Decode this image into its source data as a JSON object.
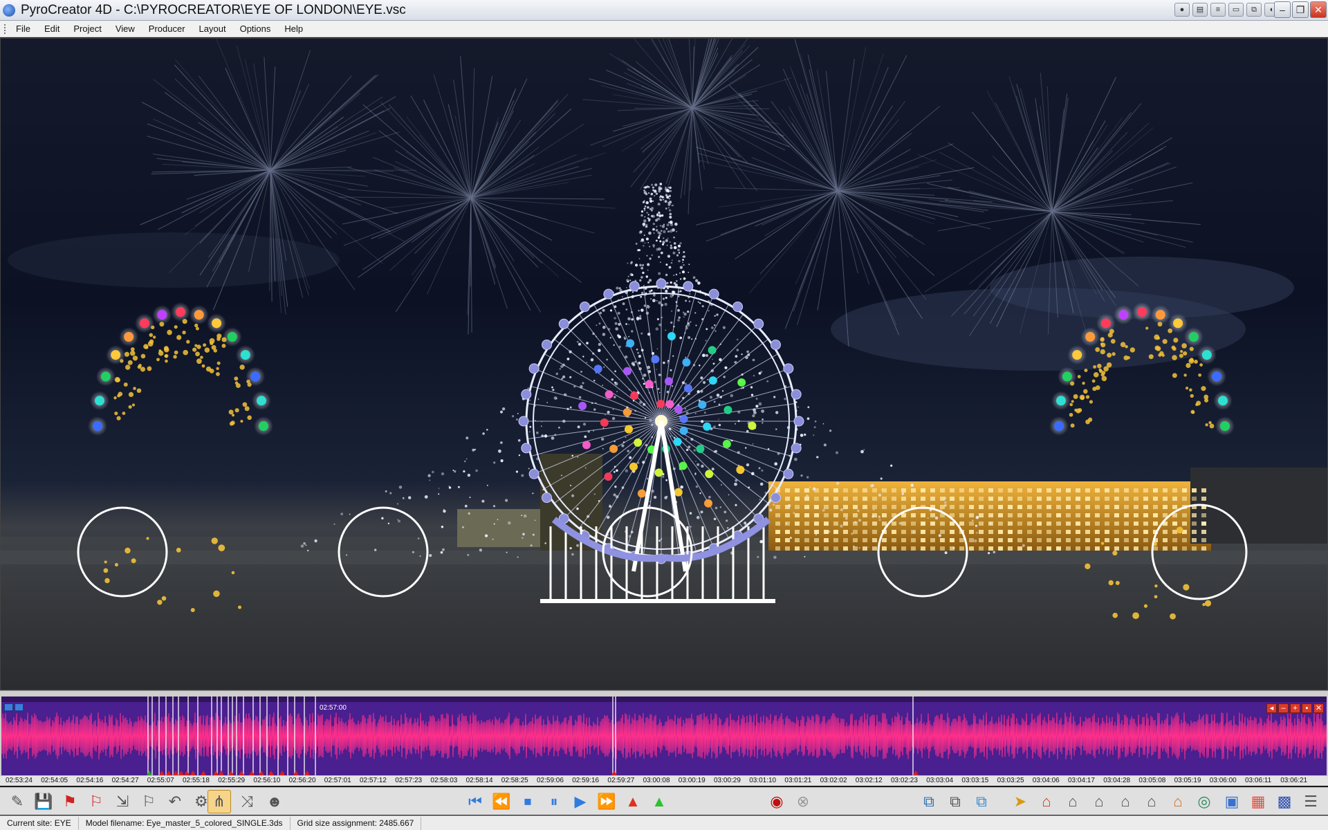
{
  "window": {
    "title": "PyroCreator 4D - C:\\PYROCREATOR\\EYE OF LONDON\\EYE.vsc"
  },
  "menu": [
    "File",
    "Edit",
    "Project",
    "View",
    "Producer",
    "Layout",
    "Options",
    "Help"
  ],
  "timeline": {
    "playhead_label": "02:57:00",
    "ticks": [
      "02:53:24",
      "02:54:05",
      "02:54:16",
      "02:54:27",
      "02:55:07",
      "02:55:18",
      "02:55:29",
      "02:56:10",
      "02:56:20",
      "02:57:01",
      "02:57:12",
      "02:57:23",
      "02:58:03",
      "02:58:14",
      "02:58:25",
      "02:59:06",
      "02:59:16",
      "02:59:27",
      "03:00:08",
      "03:00:19",
      "03:00:29",
      "03:01:10",
      "03:01:21",
      "03:02:02",
      "03:02:12",
      "03:02:23",
      "03:03:04",
      "03:03:15",
      "03:03:25",
      "03:04:06",
      "03:04:17",
      "03:04:28",
      "03:05:08",
      "03:05:19",
      "03:06:00",
      "03:06:11",
      "03:06:21"
    ],
    "wave_color": "#ff2f8a",
    "background_color": "#4a1f8f"
  },
  "toolbar": {
    "icons": [
      "select-tool-icon",
      "disk-icon",
      "red-flag-icon",
      "text-flag-icon",
      "move-cue-icon",
      "flag-gray-icon",
      "undo-icon",
      "settings-gear-icon",
      "magnet-icon",
      "arrow-split-icon",
      "person-icon",
      "skip-start-icon",
      "rewind-icon",
      "stop-icon",
      "pause-icon",
      "play-icon",
      "fast-forward-icon",
      "red-cone-icon",
      "green-cone-icon",
      "record-icon",
      "disabled-record-icon",
      "network-icon",
      "network-gray-icon",
      "network-color-icon",
      "yellow-cursor-icon",
      "house-red-icon",
      "house-cross-icon",
      "house-dark-icon",
      "house-gray-icon",
      "house-arrow-icon",
      "house-orange-icon",
      "globe-icon",
      "image-icon",
      "palette-icon",
      "people-icon",
      "list-icon"
    ]
  },
  "status": {
    "site": "Current site:  EYE",
    "model": "Model filename:  Eye_master_5_colored_SINGLE.3ds",
    "grid": "Grid size assignment:  2485.667"
  }
}
